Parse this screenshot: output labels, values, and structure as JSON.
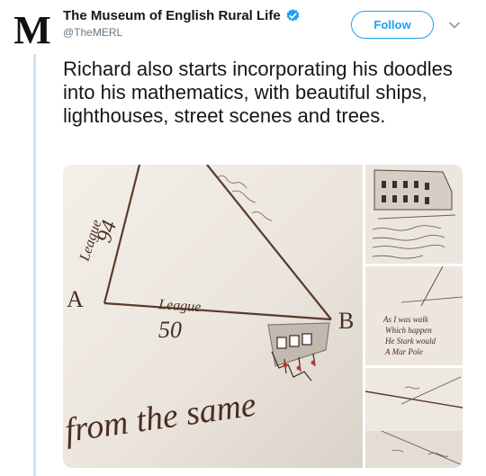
{
  "account": {
    "name": "The Museum of English Rural Life",
    "handle": "@TheMERL",
    "avatar_letter": "M",
    "verified": true
  },
  "follow_label": "Follow",
  "tweet": {
    "text": "Richard also starts incorporating his doodles into his mathematics, with beautiful ships, lighthouses, street scenes and trees."
  },
  "media": {
    "main": {
      "handwriting": [
        "League",
        "94",
        "A",
        "League",
        "50",
        "B",
        "from the same"
      ]
    },
    "thumb2": {
      "handwriting": [
        "As I was walk",
        "Which happen",
        "He Stark would",
        "A Mar Pole"
      ]
    }
  },
  "colors": {
    "accent": "#1da1f2",
    "thread_line": "#cce3f5",
    "handle_gray": "#657786"
  },
  "icons": {
    "verified": "verified-badge-icon",
    "more": "chevron-down-icon"
  }
}
